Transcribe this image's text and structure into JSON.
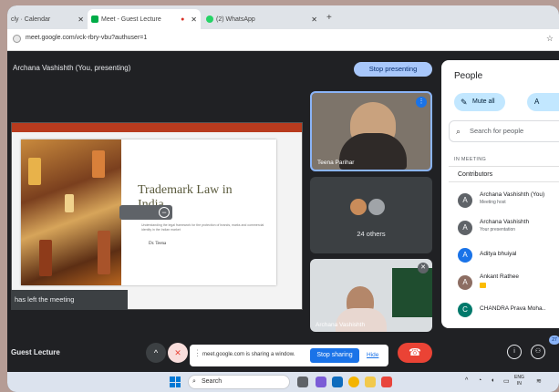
{
  "browser": {
    "tabs": [
      {
        "label": "cly · Calendar",
        "close": "✕"
      },
      {
        "label": "Meet - Guest Lecture",
        "close": "✕"
      },
      {
        "label": "(2) WhatsApp",
        "close": "✕"
      }
    ],
    "new_tab": "+",
    "url": "meet.google.com/vck-rbry-vbu?authuser=1"
  },
  "meet": {
    "presenter_label": "Archana Vashishth (You, presenting)",
    "stop_presenting": "Stop presenting",
    "meeting_title": "Guest Lecture",
    "left_toast": "has left the meeting",
    "slide": {
      "title": "Trademark Law in India",
      "subtitle": "Understanding the legal framework for the protection of brands, marks and commercial identity in the Indian market",
      "author": "Dr. Teena"
    },
    "tiles": [
      {
        "name": "Teena Parihar"
      },
      {
        "name": "24 others"
      },
      {
        "name": "Archana Vashishth"
      }
    ],
    "share_bar": {
      "message": "meet.google.com is sharing a window.",
      "stop_label": "Stop sharing",
      "hide_label": "Hide"
    },
    "participant_count": "27"
  },
  "people_panel": {
    "title": "People",
    "mute_all": "Mute all",
    "add_label": "A",
    "search_placeholder": "Search for people",
    "section_label": "IN MEETING",
    "contributors_label": "Contributors",
    "participants": [
      {
        "initial": "A",
        "name": "Archana Vashishth (You)",
        "sub": "Meeting host",
        "color": "#5f6368"
      },
      {
        "initial": "A",
        "name": "Archana Vashishth",
        "sub": "Your presentation",
        "color": "#5f6368"
      },
      {
        "initial": "A",
        "name": "Aditya bhuiyal",
        "sub": "",
        "color": "#1a73e8"
      },
      {
        "initial": "A",
        "name": "Ankant Rathee",
        "sub": "",
        "color": "#8d6e63"
      },
      {
        "initial": "C",
        "name": "CHANDRA Prava Moha..",
        "sub": "",
        "color": "#00796b"
      }
    ]
  },
  "taskbar": {
    "search_label": "Search",
    "clock_line1": "ENG",
    "clock_line2": "IN"
  }
}
